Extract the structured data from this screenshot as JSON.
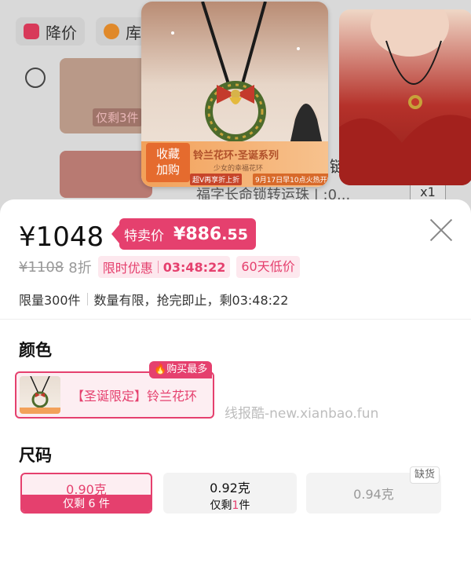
{
  "background": {
    "chips": [
      {
        "label": "降价",
        "icon": "price-tag-icon",
        "color": "#d83a5a"
      },
      {
        "label": "库",
        "icon": "lightning-icon",
        "color": "#e0892a"
      }
    ],
    "thumb_badge": "仅剩3件",
    "item_title": "福字长命锁转运珠 | :0...",
    "right_text": "链",
    "qty": "x1",
    "banner": {
      "favorite": "收藏\n加购",
      "series": "铃兰花环·圣诞系列",
      "slogan": "少女的幸福花环",
      "vip": "超V再享折上折",
      "date": "9月17日早10点火热开售"
    }
  },
  "sheet": {
    "price": "¥1048",
    "special_label": "特卖价",
    "special_currency": "¥",
    "special_int": "886",
    "special_dec": ".55",
    "original_price": "¥1108",
    "discount": "8折",
    "limited_label": "限时优惠",
    "countdown": "03:48:22",
    "low_price_badge": "60天低价",
    "stock_limit": "限量300件",
    "stock_note": "数量有限，抢完即止，剩03:48:22",
    "color_title": "颜色",
    "hot_badge": "购买最多",
    "color_option": "【圣诞限定】铃兰花环",
    "watermark": "线报酷-new.xianbao.fun",
    "size_title": "尺码",
    "sizes": [
      {
        "weight": "0.90克",
        "stock": "仅剩 6 件"
      },
      {
        "weight": "0.92克",
        "stock_prefix": "仅剩",
        "stock_num": "1",
        "stock_suffix": "件"
      },
      {
        "weight": "0.94克",
        "badge": "缺货"
      }
    ]
  },
  "colors": {
    "accent": "#e5406e",
    "accent_light": "#fdeef2",
    "text": "#111111",
    "muted": "#999999"
  }
}
